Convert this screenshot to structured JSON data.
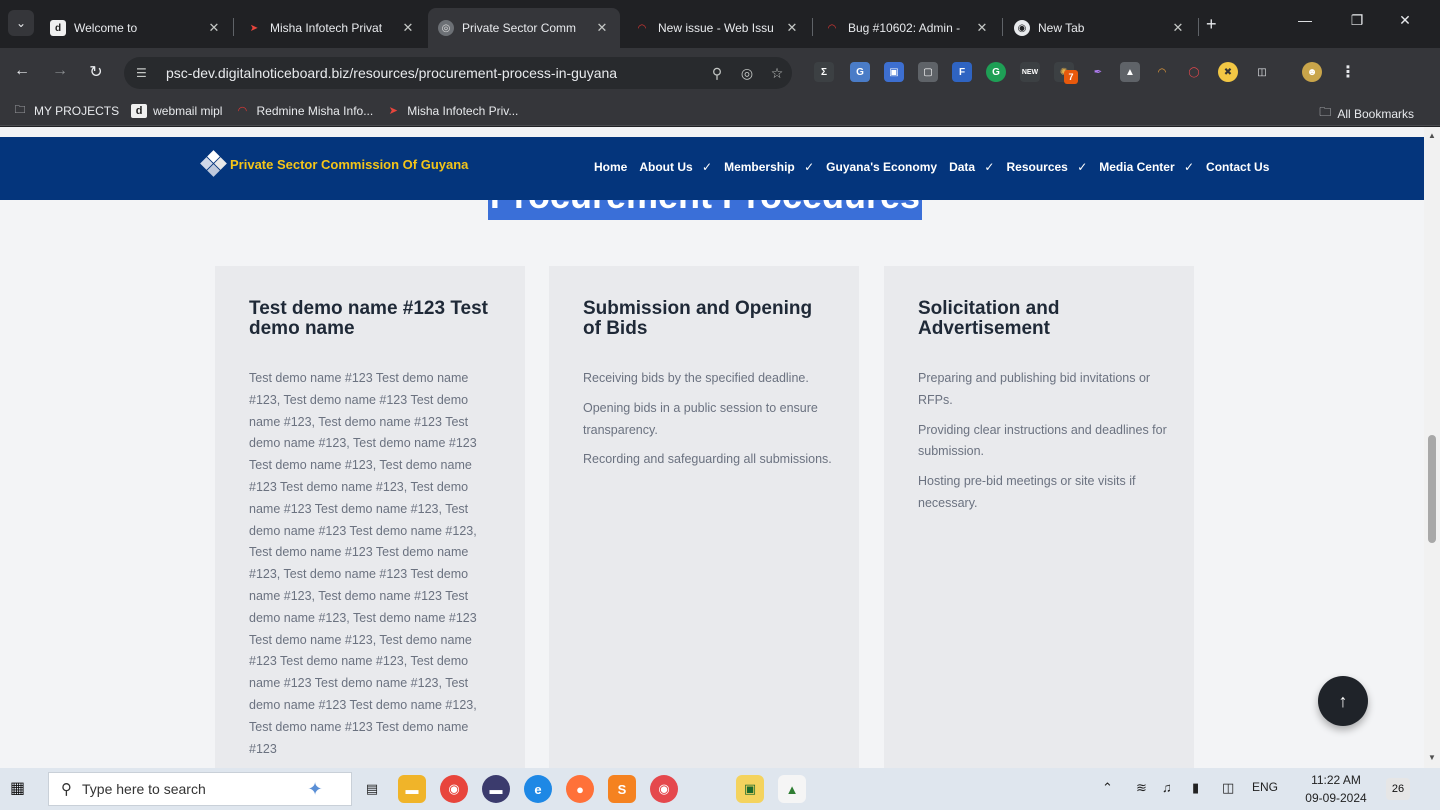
{
  "browser": {
    "tabs": [
      {
        "title": "Welcome to",
        "favicon": "tab-favicon-webmail"
      },
      {
        "title": "Misha Infotech Privat",
        "favicon": "tab-favicon-misha"
      },
      {
        "title": "Private Sector Comm",
        "favicon": "tab-favicon-psc"
      },
      {
        "title": "New issue - Web Issu",
        "favicon": "tab-favicon-redmine"
      },
      {
        "title": "Bug #10602: Admin -",
        "favicon": "tab-favicon-redmine"
      },
      {
        "title": "New Tab",
        "favicon": "tab-favicon-chrome"
      }
    ],
    "active_tab": 2,
    "url": "psc-dev.digitalnoticeboard.biz/resources/procurement-process-in-guyana",
    "extension_badge": "7",
    "bookmarks": [
      {
        "label": "MY PROJECTS",
        "icon": "folder-icon"
      },
      {
        "label": "webmail mipl",
        "icon": "webmail-icon"
      },
      {
        "label": "Redmine Misha Info...",
        "icon": "redmine-icon"
      },
      {
        "label": "Misha Infotech Priv...",
        "icon": "misha-icon"
      }
    ],
    "all_bookmarks": "All Bookmarks"
  },
  "site": {
    "logo_text": "Private Sector Commission Of Guyana",
    "nav": [
      {
        "label": "Home",
        "dropdown": false
      },
      {
        "label": "About Us",
        "dropdown": true
      },
      {
        "label": "Membership",
        "dropdown": true
      },
      {
        "label": "Guyana's Economy",
        "dropdown": false
      },
      {
        "label": "Data",
        "dropdown": true
      },
      {
        "label": "Resources",
        "dropdown": true
      },
      {
        "label": "Media Center",
        "dropdown": true
      },
      {
        "label": "Contact Us",
        "dropdown": false
      }
    ],
    "heading": "Procurement Procedures",
    "cards": [
      {
        "title": "Test demo name #123 Test demo name",
        "paragraphs": [
          "Test demo name #123 Test demo name #123,  Test demo name #123 Test demo name #123, Test demo name #123 Test demo name #123, Test demo name #123 Test demo name #123, Test demo name #123 Test demo name #123, Test demo name #123 Test demo name #123, Test demo name #123 Test demo name #123, Test demo name #123 Test demo name #123, Test demo name #123 Test demo name #123, Test demo name #123 Test demo name #123, Test demo name #123 Test demo name #123, Test demo name #123 Test demo name #123, Test demo name #123 Test demo name #123, Test demo name #123 Test demo name #123, Test demo name #123 Test demo name #123"
        ]
      },
      {
        "title": "Submission and Opening of Bids",
        "paragraphs": [
          "Receiving bids by the specified deadline.",
          "Opening bids in a public session to ensure transparency.",
          "Recording and safeguarding all submissions."
        ]
      },
      {
        "title": "Solicitation and Advertisement",
        "paragraphs": [
          "Preparing and publishing bid invitations or RFPs.",
          "Providing clear instructions and deadlines for submission.",
          "Hosting pre-bid meetings or site visits if necessary."
        ]
      }
    ]
  },
  "taskbar": {
    "search_placeholder": "Type here to search",
    "language": "ENG",
    "time": "11:22 AM",
    "date": "09-09-2024",
    "notification_count": "26"
  },
  "colors": {
    "site_nav_bg": "#04357c",
    "logo_text": "#f5c518",
    "heading_highlight": "#3a6fd8",
    "card_bg": "#e9eaed"
  }
}
